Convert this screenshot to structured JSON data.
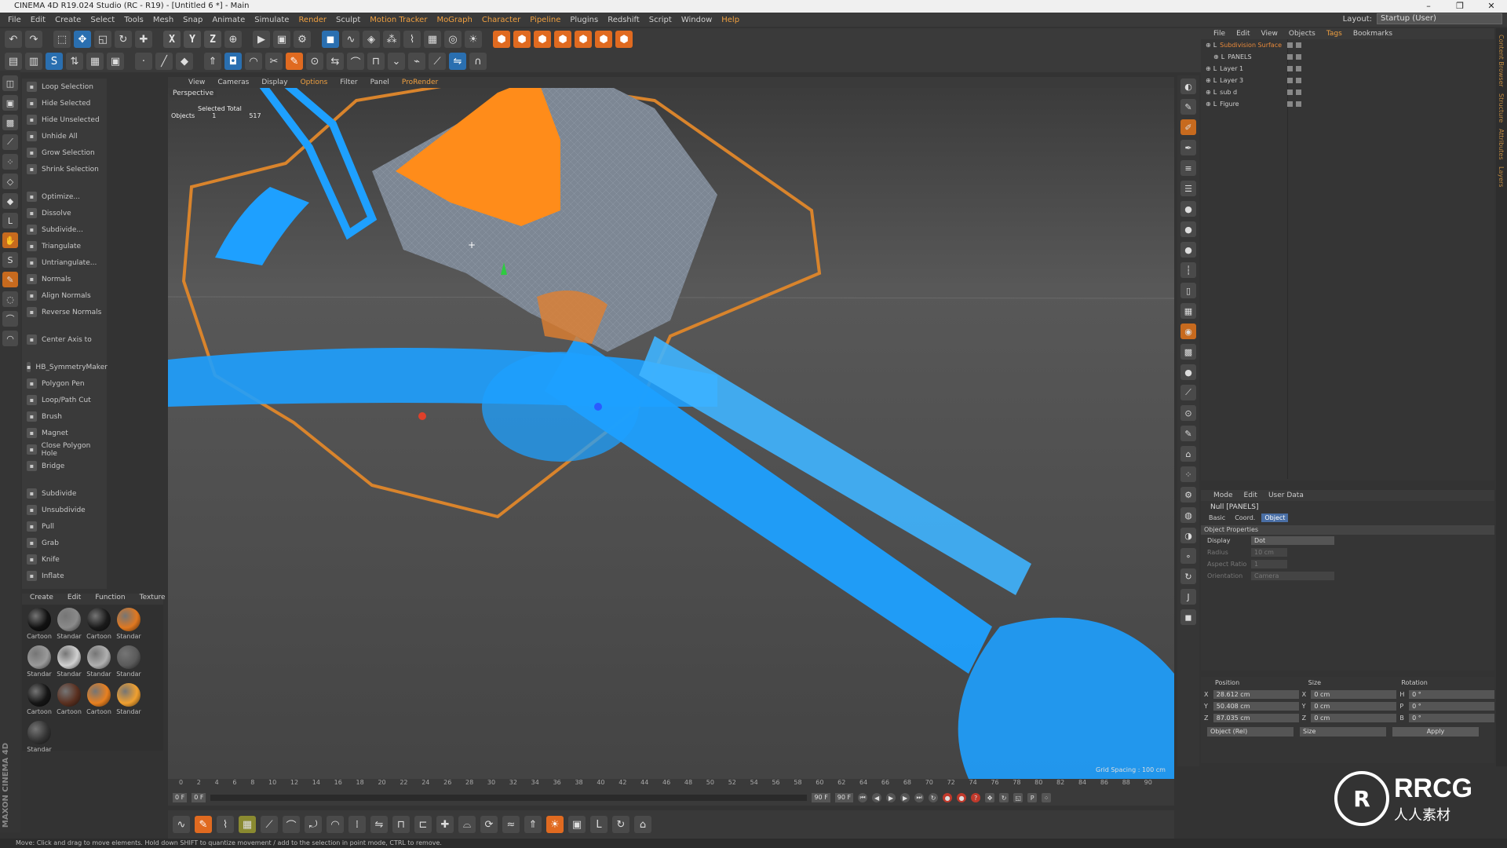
{
  "title": "CINEMA 4D R19.024 Studio (RC - R19) - [Untitled 6 *] - Main",
  "window_controls": [
    "–",
    "❐",
    "✕"
  ],
  "menu": [
    {
      "label": "File"
    },
    {
      "label": "Edit"
    },
    {
      "label": "Create"
    },
    {
      "label": "Select"
    },
    {
      "label": "Tools"
    },
    {
      "label": "Mesh"
    },
    {
      "label": "Snap"
    },
    {
      "label": "Animate"
    },
    {
      "label": "Simulate"
    },
    {
      "label": "Render",
      "hl": true
    },
    {
      "label": "Sculpt"
    },
    {
      "label": "Motion Tracker",
      "hl": true
    },
    {
      "label": "MoGraph",
      "hl": true
    },
    {
      "label": "Character",
      "hl": true
    },
    {
      "label": "Pipeline",
      "hl": true
    },
    {
      "label": "Plugins"
    },
    {
      "label": "Redshift"
    },
    {
      "label": "Script"
    },
    {
      "label": "Window"
    },
    {
      "label": "Help",
      "hl": true
    }
  ],
  "layout": {
    "label": "Layout:",
    "value": "Startup (User)"
  },
  "toolbar_axes": [
    "X",
    "Y",
    "Z"
  ],
  "commands": [
    {
      "label": "Loop Selection"
    },
    {
      "label": "Hide Selected"
    },
    {
      "label": "Hide Unselected"
    },
    {
      "label": "Unhide All"
    },
    {
      "label": "Grow Selection"
    },
    {
      "label": "Shrink Selection"
    },
    {
      "gap": true
    },
    {
      "label": "Optimize..."
    },
    {
      "label": "Dissolve"
    },
    {
      "label": "Subdivide..."
    },
    {
      "label": "Triangulate"
    },
    {
      "label": "Untriangulate..."
    },
    {
      "label": "Normals"
    },
    {
      "label": "Align Normals"
    },
    {
      "label": "Reverse Normals"
    },
    {
      "gap": true
    },
    {
      "label": "Center Axis to"
    },
    {
      "gap": true
    },
    {
      "label": "HB_SymmetryMaker"
    },
    {
      "label": "Polygon Pen"
    },
    {
      "label": "Loop/Path Cut"
    },
    {
      "label": "Brush"
    },
    {
      "label": "Magnet"
    },
    {
      "label": "Close Polygon Hole"
    },
    {
      "label": "Bridge"
    },
    {
      "gap": true
    },
    {
      "label": "Subdivide"
    },
    {
      "label": "Unsubdivide"
    },
    {
      "label": "Pull"
    },
    {
      "label": "Grab"
    },
    {
      "label": "Knife"
    },
    {
      "label": "Inflate"
    }
  ],
  "materials_menu": [
    "Create",
    "Edit",
    "Function",
    "Texture"
  ],
  "materials": [
    {
      "name": "Cartoon",
      "color": "#111111"
    },
    {
      "name": "Standar",
      "color": "#8a8a8a"
    },
    {
      "name": "Cartoon",
      "color": "#1a1a1a"
    },
    {
      "name": "Standar",
      "color": "#e07820"
    },
    {
      "name": "Standar",
      "color": "#9a9a9a"
    },
    {
      "name": "Standar",
      "color": "#d0d0d0"
    },
    {
      "name": "Standar",
      "color": "#b0b0b0"
    },
    {
      "name": "Standar",
      "color": "#5a5a5a"
    },
    {
      "name": "Cartoon",
      "color": "#151515"
    },
    {
      "name": "Cartoon",
      "color": "#5a3020"
    },
    {
      "name": "Cartoon",
      "color": "#e88020"
    },
    {
      "name": "Standar",
      "color": "#f0a030"
    },
    {
      "name": "Standar",
      "color": "#333333"
    }
  ],
  "viewport": {
    "menu": [
      {
        "label": "View"
      },
      {
        "label": "Cameras"
      },
      {
        "label": "Display"
      },
      {
        "label": "Options",
        "hl": true
      },
      {
        "label": "Filter"
      },
      {
        "label": "Panel"
      },
      {
        "label": "ProRender",
        "hl": true
      }
    ],
    "camera": "Perspective",
    "hud_header": "Selected Total",
    "hud_label": "Objects",
    "hud_selected": "1",
    "hud_total": "517",
    "grid_spacing": "Grid Spacing : 100 cm"
  },
  "timeline": {
    "ticks": [
      "0",
      "2",
      "4",
      "6",
      "8",
      "10",
      "12",
      "14",
      "16",
      "18",
      "20",
      "22",
      "24",
      "26",
      "28",
      "30",
      "32",
      "34",
      "36",
      "38",
      "40",
      "42",
      "44",
      "46",
      "48",
      "50",
      "52",
      "54",
      "56",
      "58",
      "60",
      "62",
      "64",
      "66",
      "68",
      "70",
      "72",
      "74",
      "76",
      "78",
      "80",
      "82",
      "84",
      "86",
      "88",
      "90"
    ],
    "start": "0 F",
    "current": "0 F",
    "end": "90 F",
    "end2": "90 F",
    "frame_field": "0 F"
  },
  "status": "Move: Click and drag to move elements. Hold down SHIFT to quantize movement / add to the selection in point mode, CTRL to remove.",
  "object_manager": {
    "menu": [
      {
        "label": "File"
      },
      {
        "label": "Edit"
      },
      {
        "label": "View"
      },
      {
        "label": "Objects"
      },
      {
        "label": "Tags",
        "hl": true
      },
      {
        "label": "Bookmarks"
      }
    ],
    "objects": [
      {
        "name": "Subdivision Surface",
        "sel": true,
        "indent": 0
      },
      {
        "name": "PANELS",
        "sel": false,
        "indent": 1
      },
      {
        "name": "Layer 1",
        "sel": false,
        "indent": 0
      },
      {
        "name": "Layer 3",
        "sel": false,
        "indent": 0
      },
      {
        "name": "sub d",
        "sel": false,
        "indent": 0
      },
      {
        "name": "Figure",
        "sel": false,
        "indent": 0
      }
    ]
  },
  "attributes": {
    "menu": [
      "Mode",
      "Edit",
      "User Data"
    ],
    "title": "Null [PANELS]",
    "tabs": [
      {
        "label": "Basic"
      },
      {
        "label": "Coord."
      },
      {
        "label": "Object",
        "on": true
      }
    ],
    "section": "Object Properties",
    "display_label": "Display",
    "display_value": "Dot",
    "radius_label": "Radius",
    "radius_value": "10 cm",
    "aspect_label": "Aspect Ratio",
    "aspect_value": "1",
    "orient_label": "Orientation",
    "orient_value": "Camera"
  },
  "coordinates": {
    "headers": [
      "Position",
      "Size",
      "Rotation"
    ],
    "rows": [
      {
        "axis": "X",
        "pos": "28.612 cm",
        "size": "0 cm",
        "rot_axis": "H",
        "rot": "0 °"
      },
      {
        "axis": "Y",
        "pos": "50.408 cm",
        "size": "0 cm",
        "rot_axis": "P",
        "rot": "0 °"
      },
      {
        "axis": "Z",
        "pos": "87.035 cm",
        "size": "0 cm",
        "rot_axis": "B",
        "rot": "0 °"
      }
    ],
    "mode": "Object (Rel)",
    "size_mode": "Size",
    "apply": "Apply"
  },
  "right_edge_tabs": [
    "Content Browser",
    "Structure",
    "Attributes",
    "Layers"
  ],
  "brand": {
    "c4d": "MAXON CINEMA 4D",
    "logo_mark": "R",
    "logo_text": "RRCG",
    "logo_sub": "人人素材"
  },
  "colors": {
    "accent": "#f0a040",
    "wire_blue": "#1ea0ff",
    "selection_orange": "#ff8c1a"
  }
}
